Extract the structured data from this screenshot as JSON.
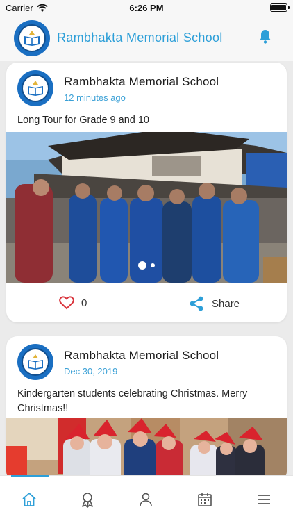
{
  "status_bar": {
    "carrier": "Carrier",
    "time": "6:26 PM"
  },
  "header": {
    "title": "Rambhakta Memorial School",
    "bell_icon": "bell-icon"
  },
  "colors": {
    "accent": "#2d9fd8",
    "like": "#d9343c",
    "logo_blue": "#1a6fc2"
  },
  "posts": [
    {
      "author": "Rambhakta Memorial School",
      "time": "12 minutes ago",
      "text": "Long Tour for Grade 9 and 10",
      "likes": "0",
      "share_label": "Share",
      "image_slides": 2,
      "active_slide": 1
    },
    {
      "author": "Rambhakta Memorial School",
      "time": "Dec 30, 2019",
      "text": "Kindergarten students celebrating Christmas. Merry Christmas!!"
    }
  ],
  "bottom_nav": {
    "items": [
      "home-icon",
      "award-icon",
      "user-icon",
      "calendar-icon",
      "menu-icon"
    ],
    "active": "home-icon"
  }
}
